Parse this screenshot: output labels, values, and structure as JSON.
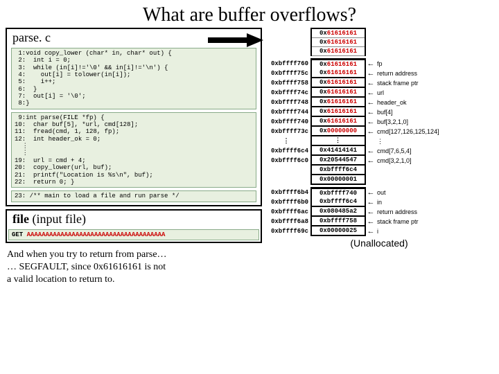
{
  "title": "What are buffer overflows?",
  "source_file": {
    "name": "parse. c",
    "block1": " 1:void copy_lower (char* in, char* out) {\n 2:  int i = 0;\n 3:  while (in[i]!='\\0' && in[i]!='\\n') {\n 4:    out[i] = tolower(in[i]);\n 5:    i++;\n 6:  }\n 7:  out[i] = '\\0';\n 8:}",
    "block2": " 9:int parse(FILE *fp) {\n10:  char buf[5], *url, cmd[128];\n11:  fread(cmd, 1, 128, fp);\n12:  int header_ok = 0;\n  ⋮\n  ⋮\n19:  url = cmd + 4;\n20:  copy_lower(url, buf);\n21:  printf(\"Location is %s\\n\", buf);\n22:  return 0; }",
    "block3": "23: /** main to load a file and run parse */"
  },
  "input_file": {
    "label_bold": "file",
    "label_rest": " (input file)",
    "cmd": "GET ",
    "payload": "AAAAAAAAAAAAAAAAAAAAAAAAAAAAAAAAAAAAA"
  },
  "caption": {
    "l1": "And when you try to return from parse…",
    "l2": "… SEGFAULT, since 0x61616161 is not",
    "l3": "a valid location to return to."
  },
  "overflow_vals": [
    "61616161",
    "61616161",
    "61616161"
  ],
  "mem": [
    {
      "addr": "0xbffff760",
      "val_pre": "0x",
      "val_red": "61616161",
      "label": "fp"
    },
    {
      "addr": "0xbffff75c",
      "val_pre": "0x",
      "val_red": "61616161",
      "label": "return address"
    },
    {
      "addr": "0xbffff758",
      "val_pre": "0x",
      "val_red": "61616161",
      "label": "stack frame ptr"
    },
    {
      "addr": "0xbffff74c",
      "val_pre": "0x",
      "val_red": "61616161",
      "label": "url"
    },
    {
      "addr": "0xbffff748",
      "val_pre": "0x",
      "val_red": "61616161",
      "label": "header_ok"
    },
    {
      "addr": "0xbffff744",
      "val_pre": "0x",
      "val_red": "61616161",
      "label": "        buf[4]"
    },
    {
      "addr": "0xbffff740",
      "val_pre": "0x",
      "val_red": "61616161",
      "label": "buf[3,2,1,0]"
    },
    {
      "addr": "0xbffff73c",
      "val_pre": "0x",
      "val_red": "00000000",
      "label": "cmd[127,126,125,124]"
    }
  ],
  "mem2": [
    {
      "addr": "0xbffff6c4",
      "val": "0x41414141",
      "label": "cmd[7,6,5,4]"
    },
    {
      "addr": "0xbffff6c0",
      "val": "0x20544547",
      "label": "cmd[3,2,1,0]"
    },
    {
      "addr": "",
      "val": "0xbffff6c4",
      "label": ""
    },
    {
      "addr": "",
      "val": "0x00000001",
      "label": ""
    }
  ],
  "mem3": [
    {
      "addr": "0xbffff6b4",
      "val": "0xbffff740",
      "label": "out"
    },
    {
      "addr": "0xbffff6b0",
      "val": "0xbffff6c4",
      "label": "in"
    },
    {
      "addr": "0xbffff6ac",
      "val": "0x080485a2",
      "label": "return address"
    },
    {
      "addr": "0xbffff6a8",
      "val": "0xbffff758",
      "label": "stack frame ptr"
    },
    {
      "addr": "0xbffff69c",
      "val": "0x00000025",
      "label": "i"
    }
  ],
  "unalloc": "(Unallocated)"
}
